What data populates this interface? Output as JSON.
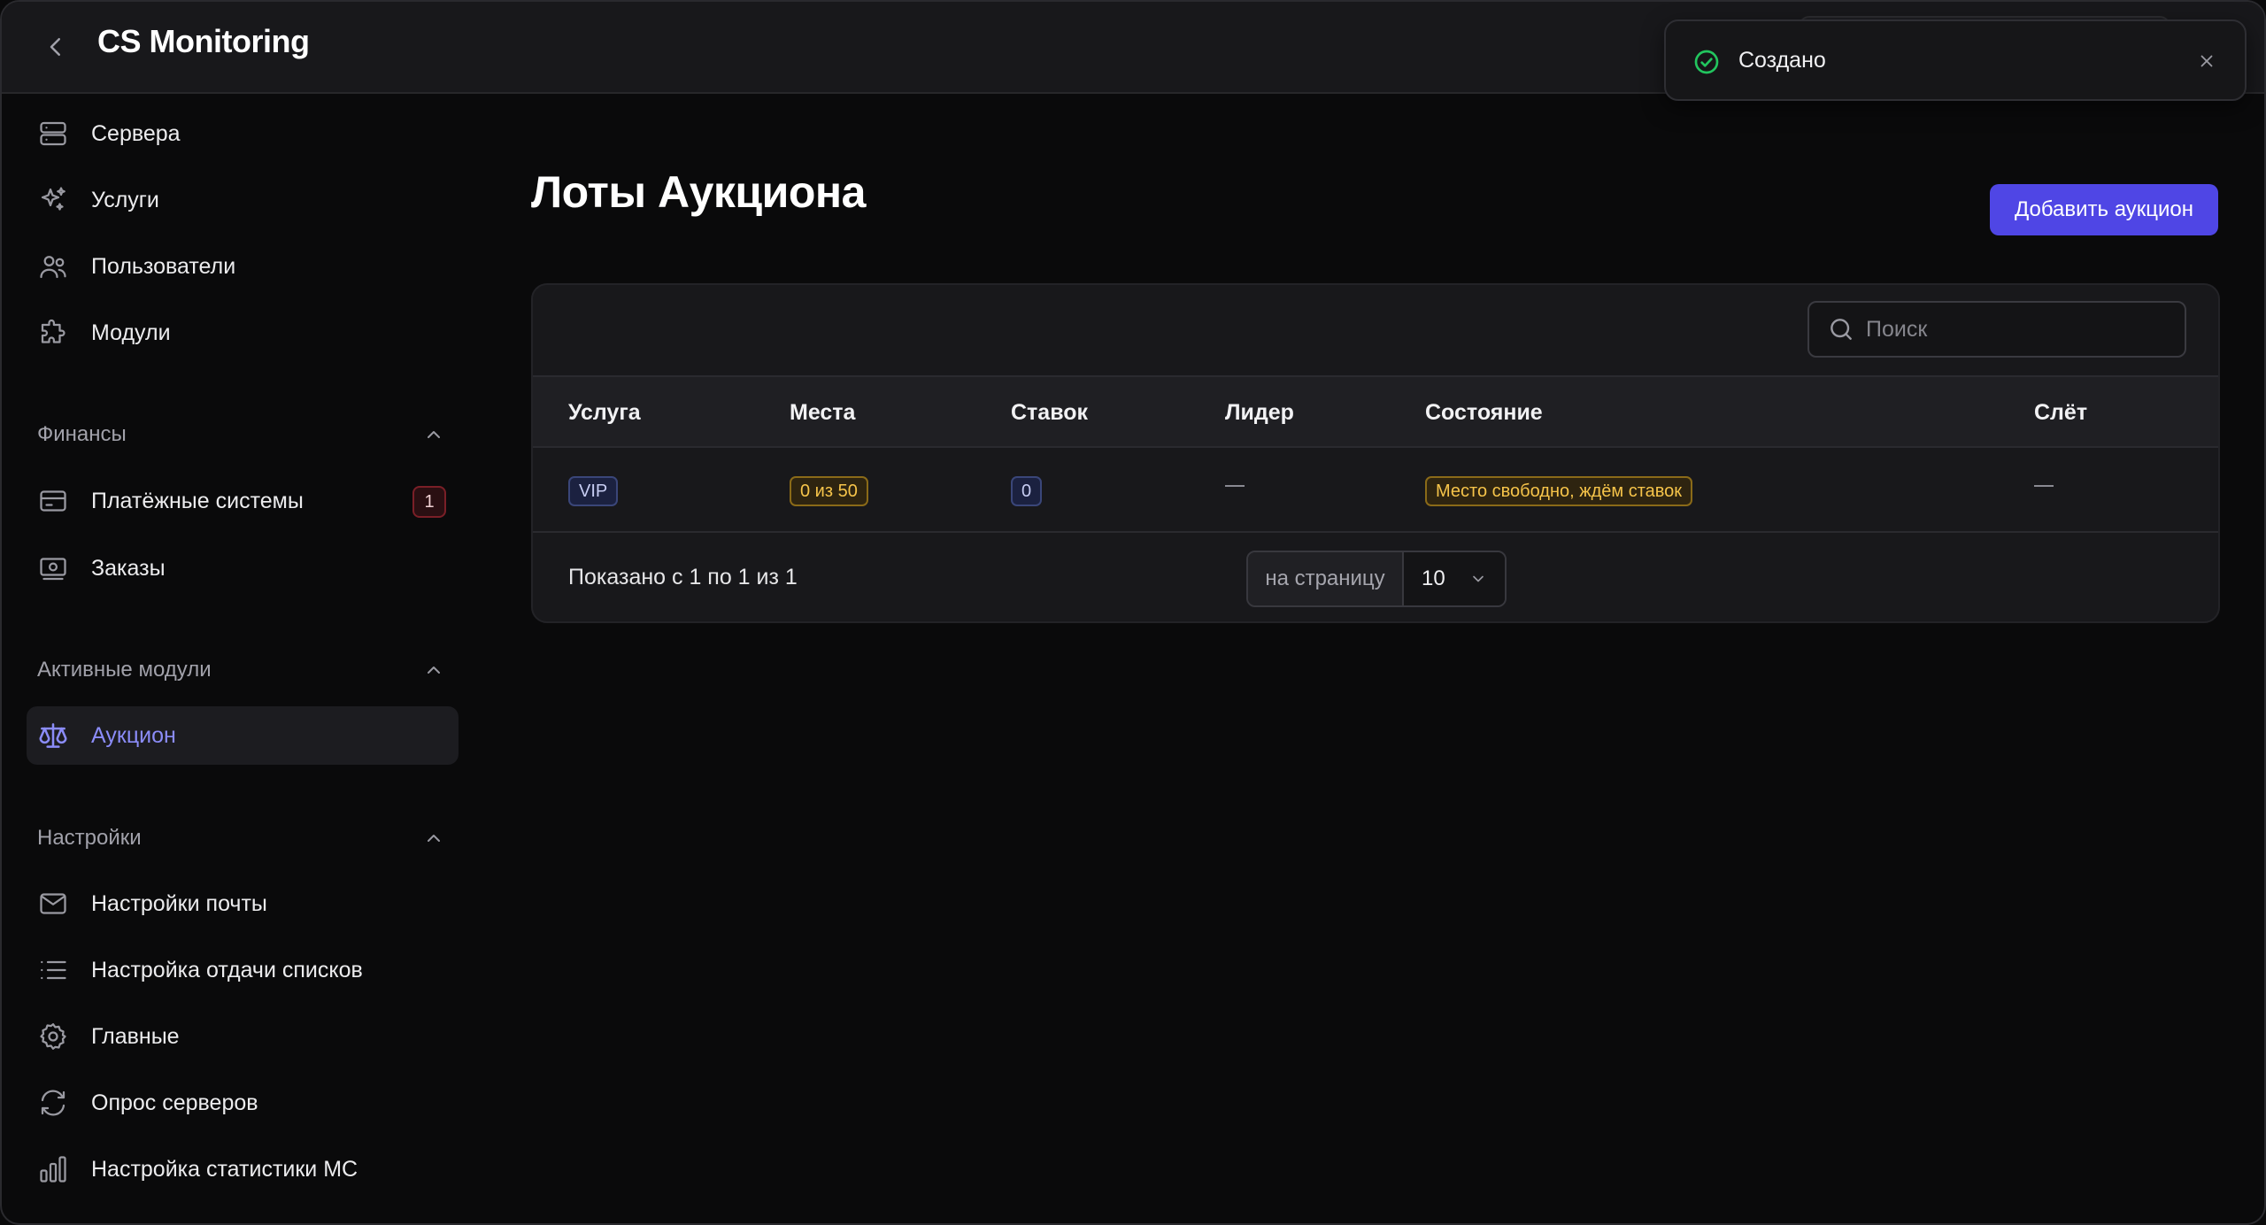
{
  "app": {
    "title": "CS Monitoring"
  },
  "toast": {
    "text": "Создано"
  },
  "sidebar": {
    "main_items": [
      {
        "label": "Сервера",
        "icon": "server-icon"
      },
      {
        "label": "Услуги",
        "icon": "sparkles-icon"
      },
      {
        "label": "Пользователи",
        "icon": "users-icon"
      },
      {
        "label": "Модули",
        "icon": "puzzle-icon"
      }
    ],
    "finance": {
      "title": "Финансы",
      "items": [
        {
          "label": "Платёжные системы",
          "icon": "credit-card-icon",
          "badge": "1"
        },
        {
          "label": "Заказы",
          "icon": "cash-icon"
        }
      ]
    },
    "active_modules": {
      "title": "Активные модули",
      "items": [
        {
          "label": "Аукцион",
          "icon": "scale-icon"
        }
      ]
    },
    "settings": {
      "title": "Настройки",
      "items": [
        {
          "label": "Настройки почты",
          "icon": "mail-icon"
        },
        {
          "label": "Настройка отдачи списков",
          "icon": "list-icon"
        },
        {
          "label": "Главные",
          "icon": "gear-icon"
        },
        {
          "label": "Опрос серверов",
          "icon": "refresh-icon"
        },
        {
          "label": "Настройка статистики MC",
          "icon": "bar-chart-icon"
        }
      ]
    }
  },
  "main": {
    "title": "Лоты Аукциона",
    "add_button": "Добавить аукцион",
    "search": {
      "placeholder": "Поиск",
      "value": ""
    },
    "table": {
      "columns": [
        "Услуга",
        "Места",
        "Ставок",
        "Лидер",
        "Состояние",
        "Слёт"
      ],
      "rows": [
        {
          "service": "VIP",
          "places": "0 из 50",
          "bids": "0",
          "leader": "—",
          "status": "Место свободно, ждём ставок",
          "expiry": "—"
        }
      ]
    },
    "footer": {
      "shown": "Показано с 1 по 1 из 1",
      "per_page_label": "на страницу",
      "per_page_value": "10"
    }
  },
  "colors": {
    "accent": "#4f46e5",
    "active_link": "#8b8cf8",
    "success": "#22c55e"
  }
}
